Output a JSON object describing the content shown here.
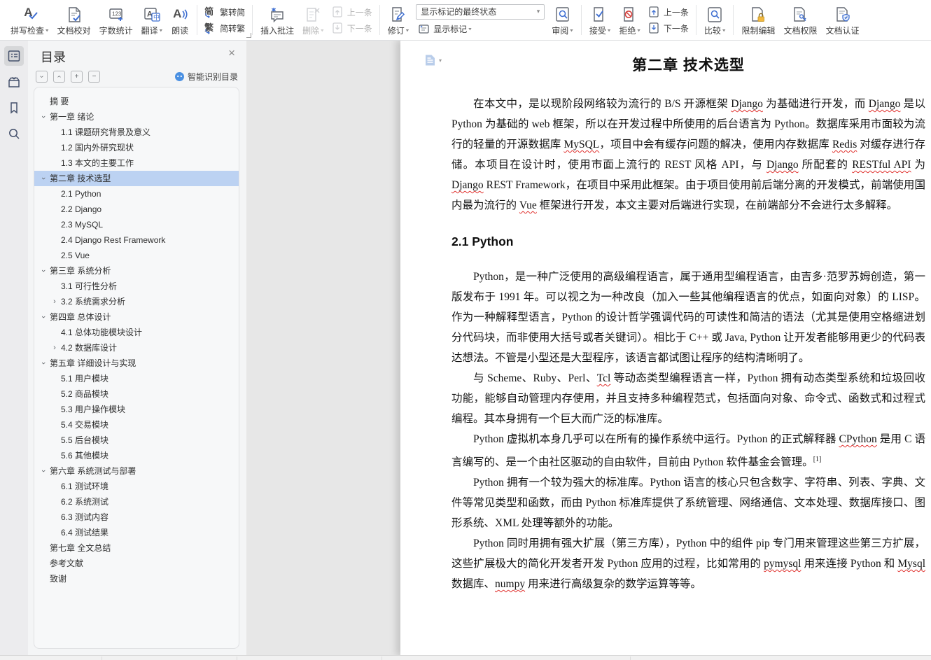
{
  "icons": {
    "close": "×",
    "chevron": "›",
    "plus": "+",
    "minus": "−",
    "caret": "▾",
    "named": [
      "spell-check-icon",
      "doc-proofread-icon",
      "word-count-icon",
      "translate-icon",
      "read-aloud-icon",
      "trad-to-simp-icon",
      "simp-to-trad-icon",
      "insert-comment-icon",
      "delete-icon",
      "prev-item-icon",
      "next-item-icon",
      "track-changes-icon",
      "show-markup-icon",
      "review-icon",
      "accept-icon",
      "reject-icon",
      "compare-icon",
      "restrict-edit-icon",
      "doc-permission-icon",
      "doc-cert-icon",
      "outline-icon",
      "chapter-nav-icon",
      "bookmark-icon",
      "search-icon",
      "smart-toc-icon",
      "page-icon"
    ]
  },
  "toolbar": {
    "spell_check": "拼写检查",
    "doc_proof": "文档校对",
    "word_count": "字数统计",
    "translate": "翻译",
    "read_aloud": "朗读",
    "trad_to_simp": "繁转简",
    "simp_to_trad": "简转繁",
    "insert_comment": "插入批注",
    "delete": "删除",
    "prev_item": "上一条",
    "next_item": "下一条",
    "track_changes": "修订",
    "markup_state_dropdown": "显示标记的最终状态",
    "show_markup": "显示标记",
    "review": "审阅",
    "accept": "接受",
    "reject": "拒绝",
    "prev_item2": "上一条",
    "next_item2": "下一条",
    "compare": "比较",
    "restrict_edit": "限制编辑",
    "doc_permission": "文档权限",
    "doc_cert": "文档认证"
  },
  "toc": {
    "title": "目录",
    "smart_recognize": "智能识别目录",
    "items": [
      {
        "lvl": 1,
        "t": "摘  要",
        "ch": ""
      },
      {
        "lvl": 1,
        "t": "第一章 绪论",
        "ch": "d"
      },
      {
        "lvl": 2,
        "t": "1.1 课题研究背景及意义",
        "ch": ""
      },
      {
        "lvl": 2,
        "t": "1.2 国内外研究现状",
        "ch": ""
      },
      {
        "lvl": 2,
        "t": "1.3 本文的主要工作",
        "ch": ""
      },
      {
        "lvl": 1,
        "t": "第二章 技术选型",
        "ch": "d",
        "sel": true
      },
      {
        "lvl": 2,
        "t": "2.1 Python",
        "ch": ""
      },
      {
        "lvl": 2,
        "t": "2.2 Django",
        "ch": ""
      },
      {
        "lvl": 2,
        "t": "2.3 MySQL",
        "ch": ""
      },
      {
        "lvl": 2,
        "t": "2.4 Django Rest Framework",
        "ch": ""
      },
      {
        "lvl": 2,
        "t": "2.5 Vue",
        "ch": ""
      },
      {
        "lvl": 1,
        "t": "第三章 系统分析",
        "ch": "d"
      },
      {
        "lvl": 2,
        "t": "3.1 可行性分析",
        "ch": ""
      },
      {
        "lvl": 2,
        "t": "3.2 系统需求分析",
        "ch": "r"
      },
      {
        "lvl": 1,
        "t": "第四章 总体设计",
        "ch": "d"
      },
      {
        "lvl": 2,
        "t": "4.1 总体功能模块设计",
        "ch": ""
      },
      {
        "lvl": 2,
        "t": "4.2 数据库设计",
        "ch": "r"
      },
      {
        "lvl": 1,
        "t": "第五章 详细设计与实现",
        "ch": "d"
      },
      {
        "lvl": 2,
        "t": "5.1 用户模块",
        "ch": ""
      },
      {
        "lvl": 2,
        "t": "5.2 商品模块",
        "ch": ""
      },
      {
        "lvl": 2,
        "t": "5.3 用户操作模块",
        "ch": ""
      },
      {
        "lvl": 2,
        "t": "5.4 交易模块",
        "ch": ""
      },
      {
        "lvl": 2,
        "t": "5.5 后台模块",
        "ch": ""
      },
      {
        "lvl": 2,
        "t": "5.6 其他模块",
        "ch": ""
      },
      {
        "lvl": 1,
        "t": "第六章 系统测试与部署",
        "ch": "d"
      },
      {
        "lvl": 2,
        "t": "6.1 测试环境",
        "ch": ""
      },
      {
        "lvl": 2,
        "t": "6.2 系统测试",
        "ch": ""
      },
      {
        "lvl": 2,
        "t": "6.3 测试内容",
        "ch": ""
      },
      {
        "lvl": 2,
        "t": "6.4 测试结果",
        "ch": ""
      },
      {
        "lvl": 1,
        "t": "第七章 全文总结",
        "ch": ""
      },
      {
        "lvl": 1,
        "t": "参考文献",
        "ch": ""
      },
      {
        "lvl": 1,
        "t": "致谢",
        "ch": ""
      }
    ]
  },
  "document": {
    "chapter_title": "第二章 技术选型",
    "p1": "在本文中，是以现阶段网络较为流行的 B/S 开源框架 Django 为基础进行开发，而 Django 是以 Python 为基础的 web 框架，所以在开发过程中所使用的后台语言为 Python。数据库采用市面较为流行的轻量的开源数据库 MySQL，项目中会有缓存问题的解决，使用内存数据库 Redis 对缓存进行存储。本项目在设计时，使用市面上流行的 REST 风格 API，与 Django 所配套的 RESTful API 为 Django REST Framework，在项目中采用此框架。由于项目使用前后端分离的开发模式，前端使用国内最为流行的 Vue 框架进行开发，本文主要对后端进行实现，在前端部分不会进行太多解释。",
    "h21": "2.1 Python",
    "p2": "Python，是一种广泛使用的高级编程语言，属于通用型编程语言，由吉多·范罗苏姆创造，第一版发布于 1991 年。可以视之为一种改良（加入一些其他编程语言的优点，如面向对象）的 LISP。作为一种解释型语言，Python 的设计哲学强调代码的可读性和简洁的语法（尤其是使用空格缩进划分代码块，而非使用大括号或者关键词）。相比于 C++ 或 Java, Python 让开发者能够用更少的代码表达想法。不管是小型还是大型程序，该语言都试图让程序的结构清晰明了。",
    "p3": "与 Scheme、Ruby、Perl、Tcl 等动态类型编程语言一样，Python 拥有动态类型系统和垃圾回收功能，能够自动管理内存使用，并且支持多种编程范式，包括面向对象、命令式、函数式和过程式编程。其本身拥有一个巨大而广泛的标准库。",
    "p4": "Python 虚拟机本身几乎可以在所有的操作系统中运行。Python 的正式解释器 CPython 是用 C 语言编写的、是一个由社区驱动的自由软件，目前由 Python 软件基金会管理。",
    "p4_sup": "[1]",
    "p5": "Python 拥有一个较为强大的标准库。Python 语言的核心只包含数字、字符串、列表、字典、文件等常见类型和函数，而由 Python 标准库提供了系统管理、网络通信、文本处理、数据库接口、图形系统、XML 处理等额外的功能。",
    "p6": "Python 同时用拥有强大扩展（第三方库），Python 中的组件 pip 专门用来管理这些第三方扩展，这些扩展极大的简化开发者开发 Python 应用的过程，比如常用的 pymysql 用来连接 Python 和 Mysql 数据库、numpy 用来进行高级复杂的数学运算等等。",
    "squiggle_words": [
      "RESTful API",
      "pymysql",
      "CPython",
      "Django",
      "MySQL",
      "Mysql",
      "Redis",
      "numpy",
      "Vue",
      "Tcl"
    ]
  }
}
